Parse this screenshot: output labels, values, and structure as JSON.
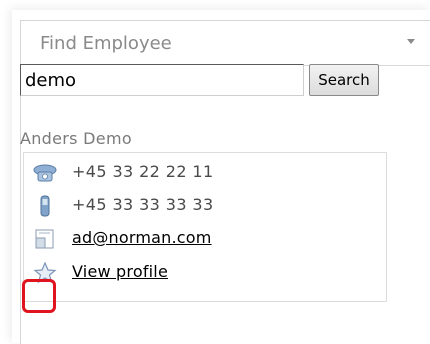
{
  "widget": {
    "title": "Find Employee"
  },
  "search": {
    "value": "demo",
    "button_label": "Search"
  },
  "result": {
    "name": "Anders Demo",
    "phone": "+45 33 22 22 11",
    "mobile": "+45 33 33 33 33",
    "email": "ad@norman.com",
    "profile_label": "View profile"
  },
  "icons": [
    "phone-icon",
    "mobile-icon",
    "email-icon",
    "star-icon",
    "collapse-arrow-icon"
  ],
  "colors": {
    "highlight": "#e0141e",
    "title": "#8a8a8a",
    "phone_icon": "#6b8fb5"
  }
}
